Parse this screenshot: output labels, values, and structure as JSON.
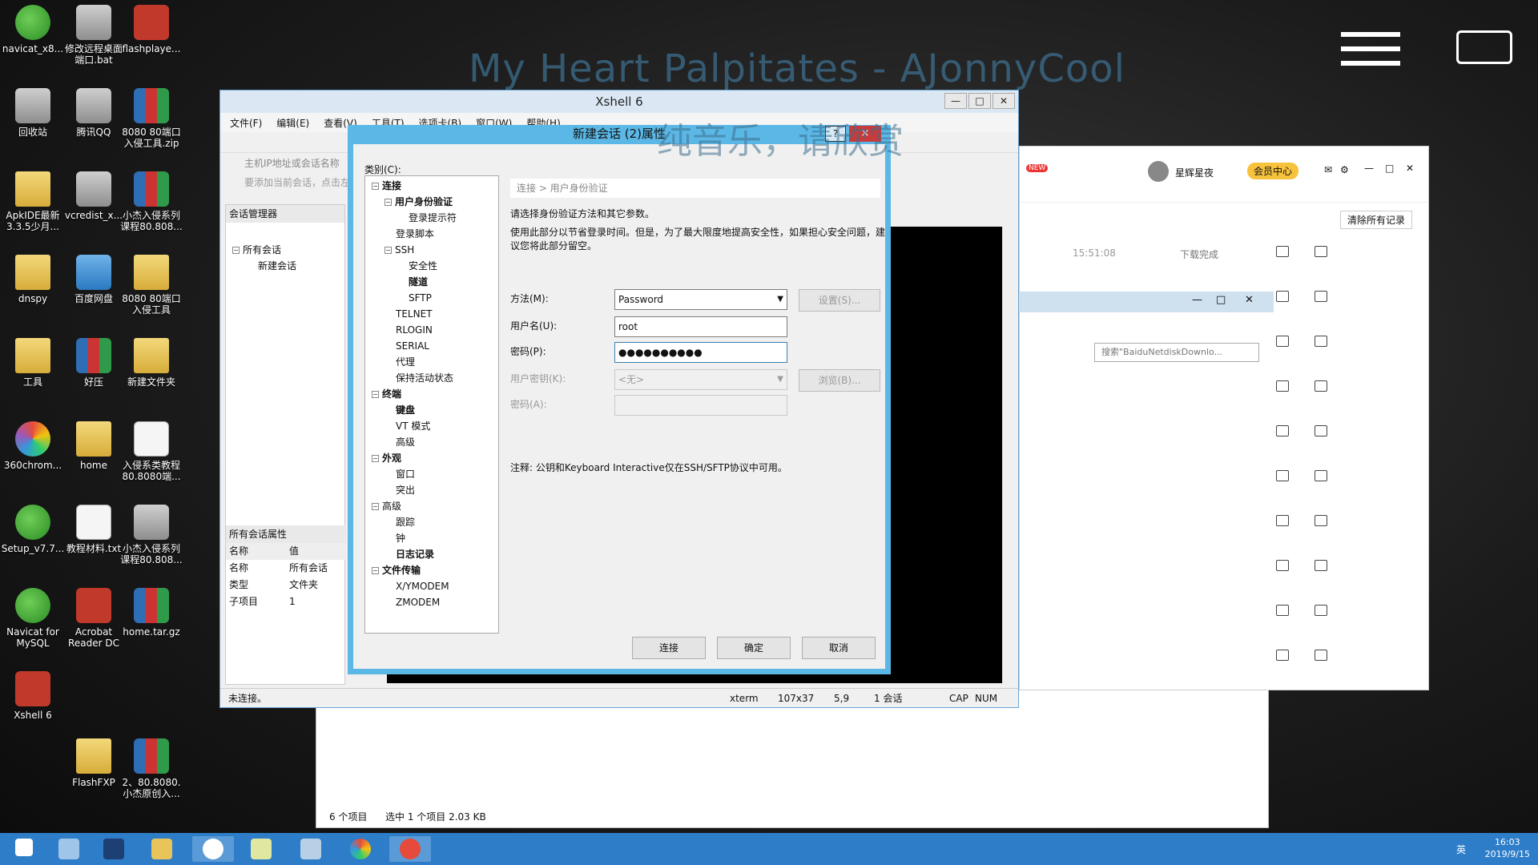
{
  "desktop": {
    "banner_text": "My Heart Palpitates - AJonnyCool",
    "overlay_text": "纯音乐，请欣赏",
    "icons": [
      {
        "label": "navicat_x8...",
        "icon": "navicat-icon"
      },
      {
        "label": "修改远程桌面端口.bat",
        "icon": "bat-file-icon"
      },
      {
        "label": "flashplaye...",
        "icon": "flash-icon"
      },
      {
        "label": "回收站",
        "icon": "recycle-bin-icon"
      },
      {
        "label": "腾讯QQ",
        "icon": "qq-icon"
      },
      {
        "label": "8080 80端口入侵工具.zip",
        "icon": "archive-icon"
      },
      {
        "label": "ApkIDE最新3.3.5少月...",
        "icon": "folder-icon"
      },
      {
        "label": "vcredist_x...",
        "icon": "installer-icon"
      },
      {
        "label": "小杰入侵系列课程80.808...",
        "icon": "archive-icon"
      },
      {
        "label": "dnspy",
        "icon": "folder-icon"
      },
      {
        "label": "百度网盘",
        "icon": "baidu-netdisk-icon"
      },
      {
        "label": "8080 80端口入侵工具",
        "icon": "folder-icon"
      },
      {
        "label": "工具",
        "icon": "folder-icon"
      },
      {
        "label": "好压",
        "icon": "archive-icon"
      },
      {
        "label": "新建文件夹",
        "icon": "folder-icon"
      },
      {
        "label": "360chrom...",
        "icon": "browser-icon"
      },
      {
        "label": "home",
        "icon": "folder-icon"
      },
      {
        "label": "入侵系类教程80.8080端...",
        "icon": "document-icon"
      },
      {
        "label": "Setup_v7.7...",
        "icon": "setup-icon"
      },
      {
        "label": "教程材料.txt",
        "icon": "text-file-icon"
      },
      {
        "label": "小杰入侵系列课程80.808...",
        "icon": "installer-icon"
      },
      {
        "label": "Navicat for MySQL",
        "icon": "navicat-icon"
      },
      {
        "label": "Acrobat Reader DC",
        "icon": "pdf-icon"
      },
      {
        "label": "home.tar.gz",
        "icon": "archive-icon"
      },
      {
        "label": "Xshell 6",
        "icon": "xshell-icon"
      },
      {
        "label": "FlashFXP",
        "icon": "folder-icon"
      },
      {
        "label": "2、80.8080.小杰原创入...",
        "icon": "archive-icon"
      }
    ]
  },
  "xshell": {
    "title": "Xshell 6",
    "menu": [
      "文件(F)",
      "编辑(E)",
      "查看(V)",
      "工具(T)",
      "选项卡(B)",
      "窗口(W)",
      "帮助(H)"
    ],
    "address_placeholder": "主机IP地址或会话名称",
    "hint": "要添加当前会话，点击左侧的箭头按钮。",
    "session_manager": "会话管理器",
    "tree": {
      "root": "所有会话",
      "child": "新建会话"
    },
    "props": {
      "title": "所有会话属性",
      "header": [
        "名称",
        "值"
      ],
      "rows": [
        [
          "名称",
          "所有会话"
        ],
        [
          "类型",
          "文件夹"
        ],
        [
          "子项目",
          "1"
        ]
      ]
    },
    "status": {
      "left": "未连接。",
      "term": "xterm",
      "size": "107x37",
      "pos": "5,9",
      "sessions": "1 会话",
      "cap": "CAP",
      "num": "NUM"
    }
  },
  "dialog": {
    "title": "新建会话 (2)属性",
    "help": "?",
    "close": "×",
    "category_label": "类别(C):",
    "tree": [
      {
        "label": "连接",
        "level": 0,
        "bold": true,
        "exp": "−"
      },
      {
        "label": "用户身份验证",
        "level": 1,
        "bold": true,
        "exp": "−"
      },
      {
        "label": "登录提示符",
        "level": 2
      },
      {
        "label": "登录脚本",
        "level": 1
      },
      {
        "label": "SSH",
        "level": 1,
        "exp": "−"
      },
      {
        "label": "安全性",
        "level": 2
      },
      {
        "label": "隧道",
        "level": 2,
        "bold": true
      },
      {
        "label": "SFTP",
        "level": 2
      },
      {
        "label": "TELNET",
        "level": 1
      },
      {
        "label": "RLOGIN",
        "level": 1
      },
      {
        "label": "SERIAL",
        "level": 1
      },
      {
        "label": "代理",
        "level": 1
      },
      {
        "label": "保持活动状态",
        "level": 1
      },
      {
        "label": "终端",
        "level": 0,
        "bold": true,
        "exp": "−"
      },
      {
        "label": "键盘",
        "level": 1,
        "bold": true
      },
      {
        "label": "VT 模式",
        "level": 1
      },
      {
        "label": "高级",
        "level": 1
      },
      {
        "label": "外观",
        "level": 0,
        "bold": true,
        "exp": "−"
      },
      {
        "label": "窗口",
        "level": 1
      },
      {
        "label": "突出",
        "level": 1
      },
      {
        "label": "高级",
        "level": 0,
        "exp": "−"
      },
      {
        "label": "跟踪",
        "level": 1
      },
      {
        "label": "钟",
        "level": 1
      },
      {
        "label": "日志记录",
        "level": 1,
        "bold": true
      },
      {
        "label": "文件传输",
        "level": 0,
        "bold": true,
        "exp": "−"
      },
      {
        "label": "X/YMODEM",
        "level": 1
      },
      {
        "label": "ZMODEM",
        "level": 1
      }
    ],
    "breadcrumb": "连接 > 用户身份验证",
    "desc1": "请选择身份验证方法和其它参数。",
    "desc2": "使用此部分以节省登录时间。但是，为了最大限度地提高安全性，如果担心安全问题，建议您将此部分留空。",
    "method_label": "方法(M):",
    "method_value": "Password",
    "settings_button": "设置(S)...",
    "username_label": "用户名(U):",
    "username_value": "root",
    "password_label": "密码(P):",
    "password_value": "●●●●●●●●●●",
    "userkey_label": "用户密钥(K):",
    "userkey_value": "<无>",
    "browse_button": "浏览(B)...",
    "passphrase_label": "密码(A):",
    "note": "注释: 公钥和Keyboard Interactive仅在SSH/SFTP协议中可用。",
    "connect_button": "连接",
    "ok_button": "确定",
    "cancel_button": "取消"
  },
  "baidu": {
    "new_badge": "NEW",
    "user": "星辉星夜",
    "vip": "会员中心",
    "clear_button": "清除所有记录",
    "time": "15:51:08",
    "download_done": "下载完成",
    "search_placeholder": "搜索\"BaiduNetdiskDownlo...",
    "status_items": "6 个项目",
    "status_selected": "选中 1 个项目 2.03 KB"
  },
  "taskbar": {
    "time": "16:03",
    "date": "2019/9/15",
    "lang": "英"
  }
}
